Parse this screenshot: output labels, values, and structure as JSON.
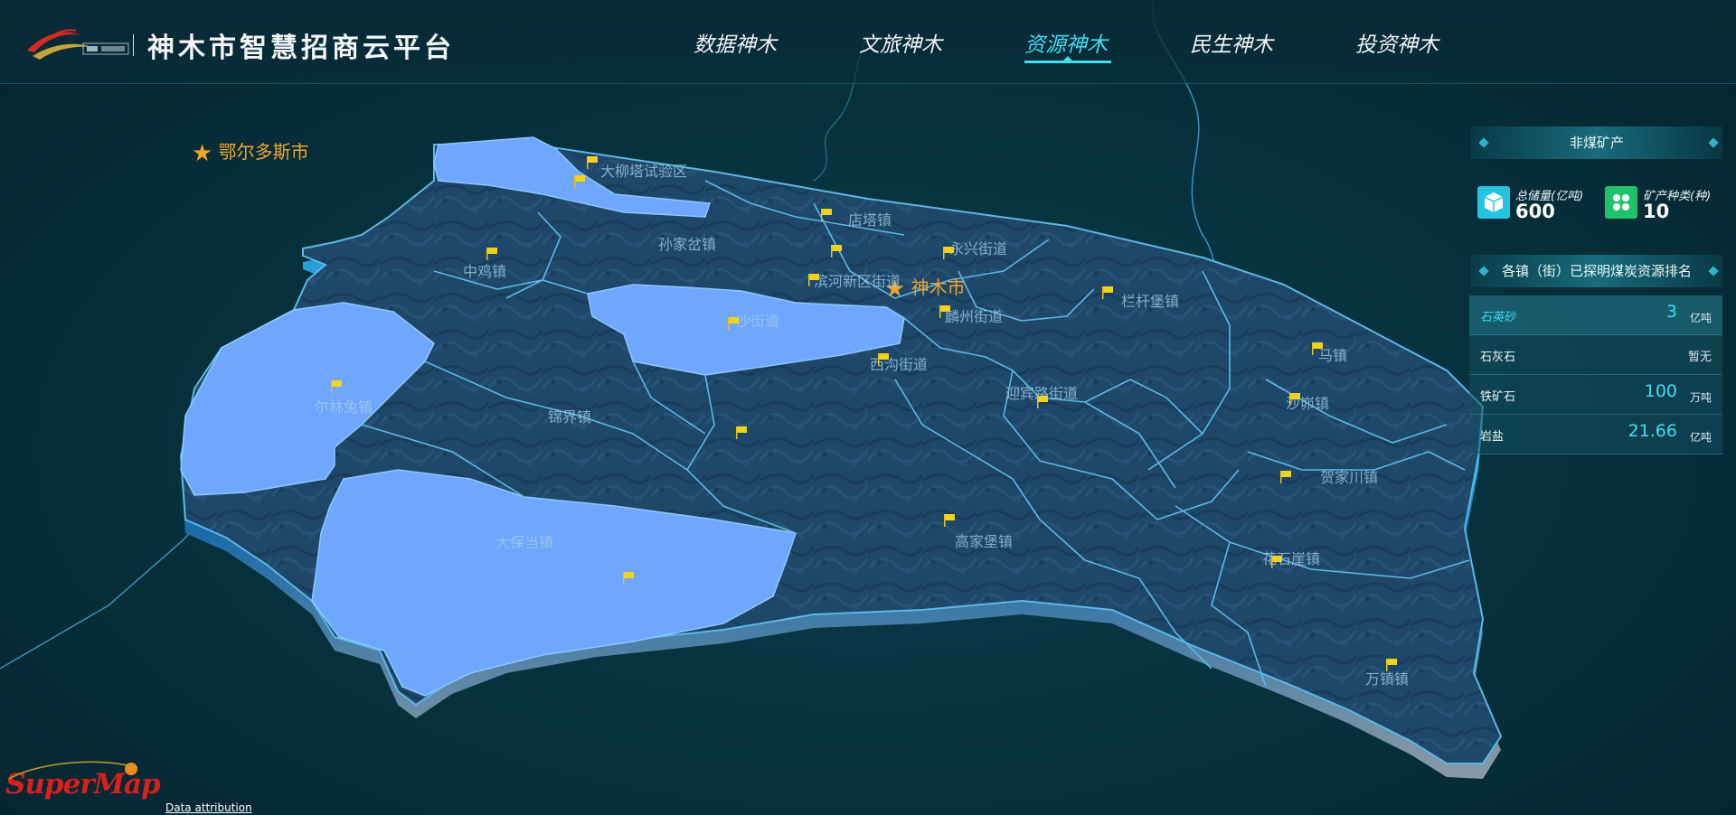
{
  "header": {
    "app_title": "神木市智慧招商云平台",
    "nav": [
      {
        "label": "数据神木",
        "active": false
      },
      {
        "label": "文旅神木",
        "active": false
      },
      {
        "label": "资源神木",
        "active": true
      },
      {
        "label": "民生神木",
        "active": false
      },
      {
        "label": "投资神木",
        "active": false
      }
    ]
  },
  "map": {
    "cities": {
      "ordos": "鄂尔多斯市",
      "shenmu": "神木市"
    },
    "townships": [
      "大柳塔试验区",
      "店塔镇",
      "孙家岔镇",
      "永兴街道",
      "中鸡镇",
      "滨河新区街道",
      "麟州街道",
      "栏杆堡镇",
      "沙街道",
      "西沟街道",
      "马镇",
      "迎宾路街道",
      "尔林兔镇",
      "锦界镇",
      "沙峁镇",
      "贺家川镇",
      "大保当镇",
      "高家堡镇",
      "花石崖镇",
      "万镇镇"
    ],
    "colors": {
      "highlight": "#6fa6ff",
      "terrain": "#1d4668",
      "border": "#5bb8e8",
      "edge_glow": "#19e6f7"
    }
  },
  "panel": {
    "section_title": "非煤矿产",
    "stats": [
      {
        "label": "总储量(亿吨)",
        "value": "600",
        "icon": "cube-icon"
      },
      {
        "label": "矿产种类(种)",
        "value": "10",
        "icon": "grid-icon"
      }
    ],
    "ranking_title": "各镇（街）已探明煤炭资源排名",
    "ranking": [
      {
        "name": "石英砂",
        "value": "3",
        "unit": "亿吨"
      },
      {
        "name": "石灰石",
        "value": "暂无",
        "unit": ""
      },
      {
        "name": "铁矿石",
        "value": "100",
        "unit": "万吨"
      },
      {
        "name": "岩盐",
        "value": "21.66",
        "unit": "亿吨"
      }
    ]
  },
  "footer": {
    "supermap": "SuperMap",
    "attribution": "Data attribution"
  }
}
